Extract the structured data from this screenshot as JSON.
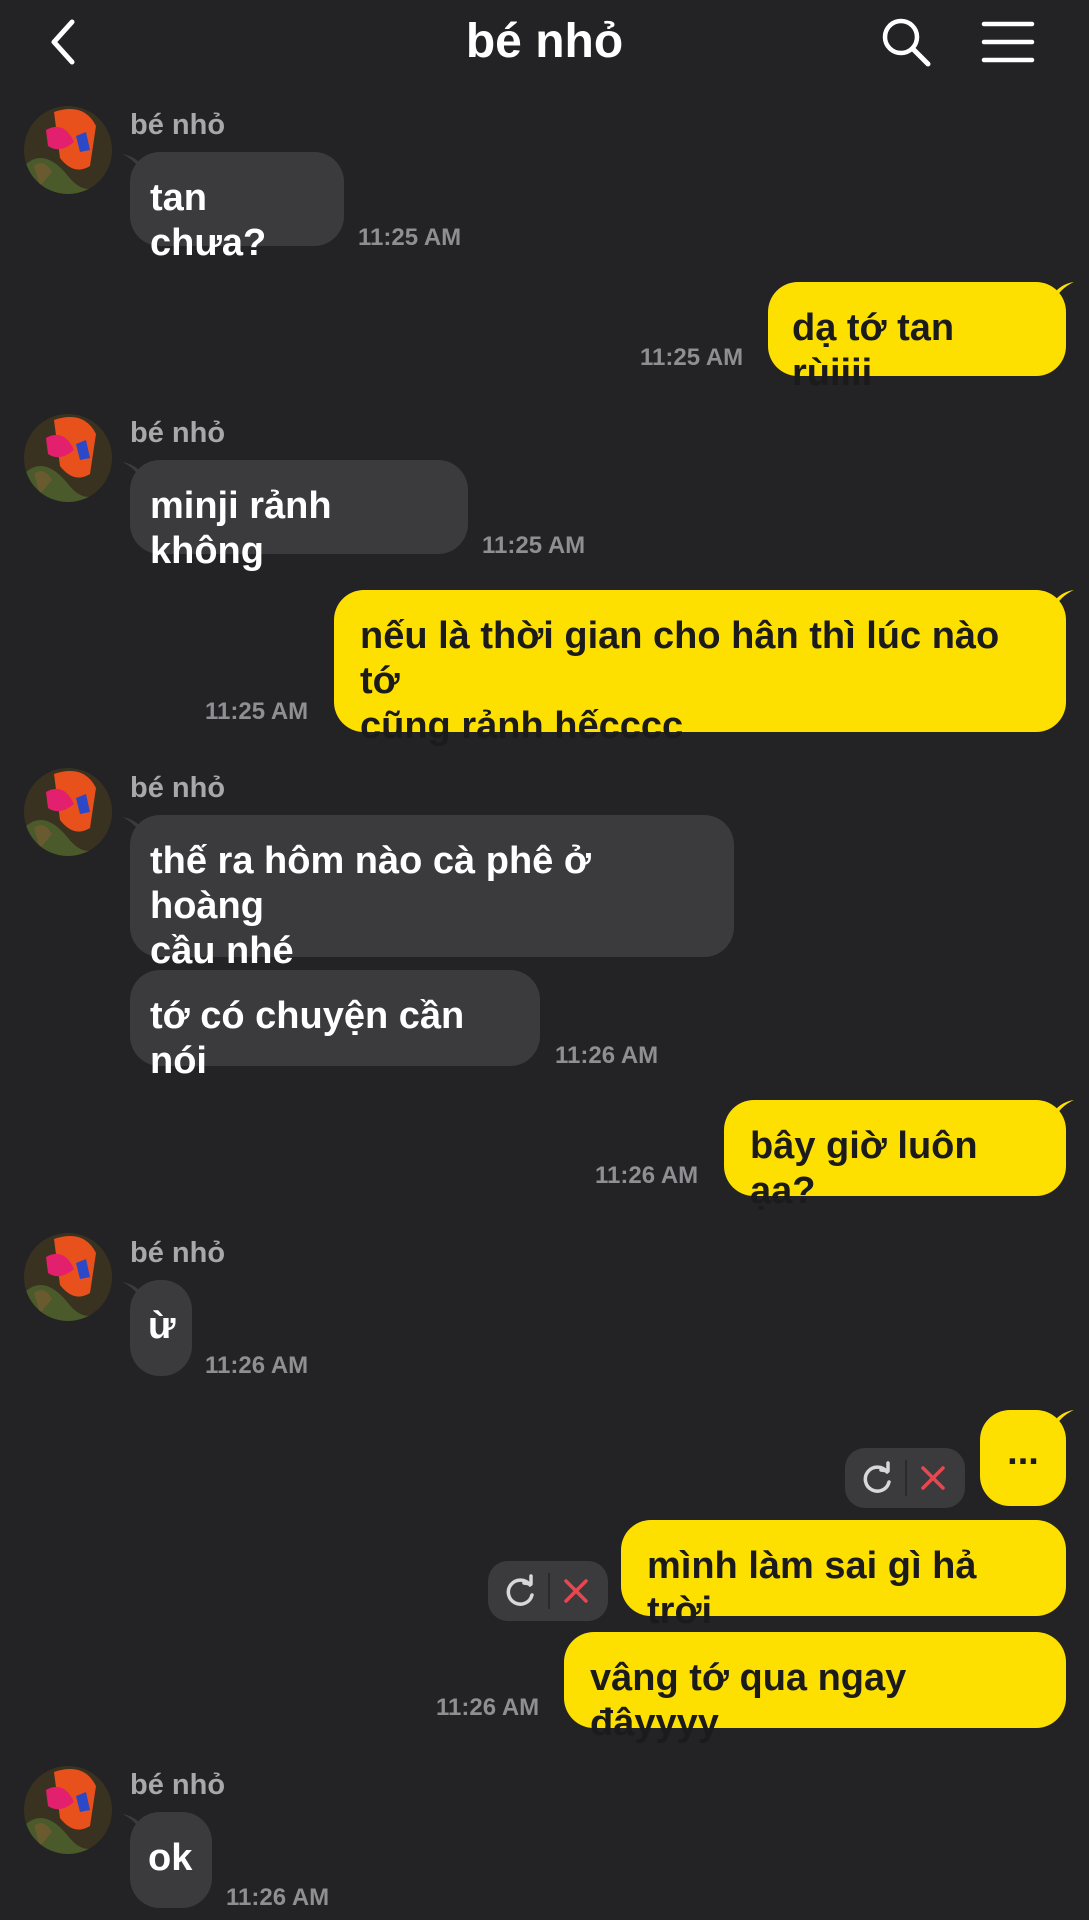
{
  "header": {
    "title": "bé nhỏ",
    "back_icon": "chevron-left-icon",
    "search_icon": "search-icon",
    "menu_icon": "hamburger-menu-icon"
  },
  "colors": {
    "background": "#232325",
    "incoming_bubble": "#3b3b3e",
    "outgoing_bubble": "#fde000",
    "timestamp": "#8e8e93",
    "cancel": "#e8474f"
  },
  "messages": [
    {
      "sender": "bé nhỏ",
      "text": "tan chưa?",
      "time": "11:25 AM"
    },
    {
      "text": "dạ tớ tan rùiiii",
      "time": "11:25 AM"
    },
    {
      "sender": "bé nhỏ",
      "text": "minji rảnh không",
      "time": "11:25 AM"
    },
    {
      "line1": "nếu là thời gian cho hân thì lúc nào tớ",
      "line2": "cũng rảnh hếcccc",
      "time": "11:25 AM"
    },
    {
      "sender": "bé nhỏ",
      "line1": "thế ra hôm nào cà phê ở hoàng",
      "line2": "cầu nhé"
    },
    {
      "text": "tớ có chuyện cần nói",
      "time": "11:26 AM"
    },
    {
      "text": "bây giờ luôn ạa?",
      "time": "11:26 AM"
    },
    {
      "sender": "bé nhỏ",
      "text": "ừ",
      "time": "11:26 AM"
    },
    {
      "text": "..."
    },
    {
      "text": "mình làm sai gì hả trời"
    },
    {
      "text": "vâng tớ qua ngay đâyyyy",
      "time": "11:26 AM"
    },
    {
      "sender": "bé nhỏ",
      "text": "ok",
      "time": "11:26 AM"
    }
  ]
}
